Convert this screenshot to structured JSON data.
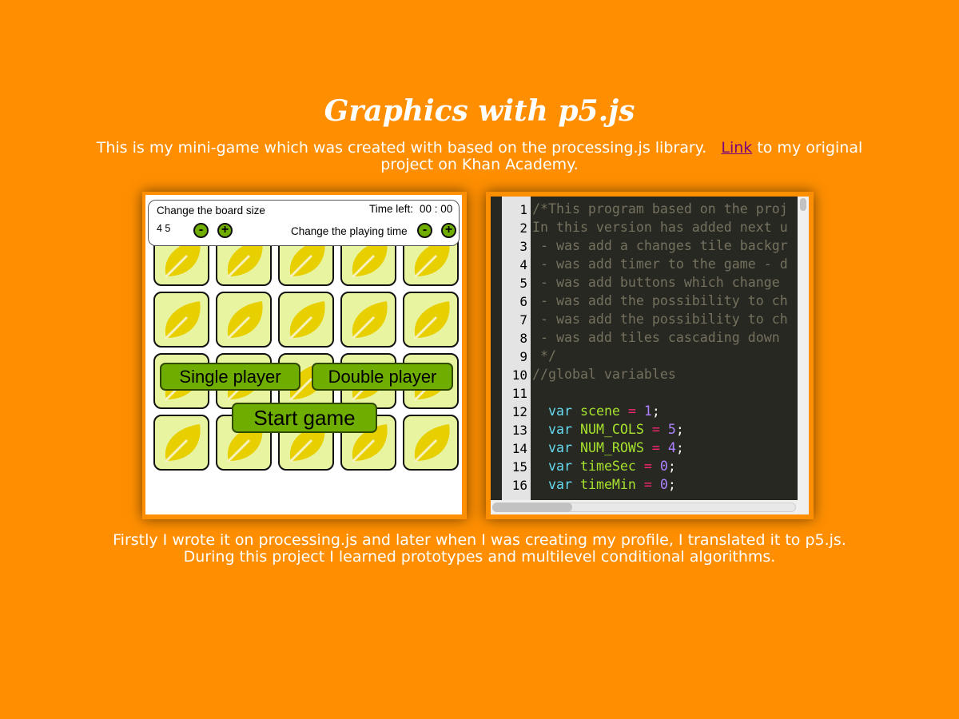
{
  "page": {
    "title": "Graphics with p5.js",
    "intro_before_link": "This is my mini-game which was created with based on the processing.js library.",
    "intro_link": "Link",
    "intro_after_link": " to my original project on Khan Academy.",
    "outro": "Firstly I wrote it on processing.js and later when I was creating my profile, I translated it to p5.js. During this project I learned prototypes and multilevel conditional algorithms."
  },
  "game": {
    "board_size_label": "Change the board size",
    "board_size_value": "4 5",
    "time_left_label": "Time left:",
    "time_left_value": "00 : 00",
    "playing_time_label": "Change the playing time",
    "minus": "-",
    "plus": "+",
    "single_player": "Single player",
    "double_player": "Double player",
    "start_game": "Start game",
    "tile_icon": "leaf-icon",
    "colors": {
      "tile_bg": "#e8f4a0",
      "leaf": "#e8d000",
      "button": "#6fae00",
      "page_bg": "#ff8f00"
    }
  },
  "code": {
    "line_numbers": [
      "1",
      "2",
      "3",
      "4",
      "5",
      "6",
      "7",
      "8",
      "9",
      "10",
      "11",
      "12",
      "13",
      "14",
      "15",
      "16"
    ],
    "lines": [
      "/*This program based on the proj",
      "In this version has added next u",
      " - was add a changes tile backgr",
      " - was add timer to the game - d",
      " - was add buttons which change ",
      " - was add the possibility to ch",
      " - was add the possibility to ch",
      " - was add tiles cascading down ",
      " */",
      "//global variables",
      "",
      "  var scene = 1;",
      "  var NUM_COLS = 5;",
      "  var NUM_ROWS = 4;",
      "  var timeSec = 0;",
      "  var timeMin = 0;"
    ]
  }
}
